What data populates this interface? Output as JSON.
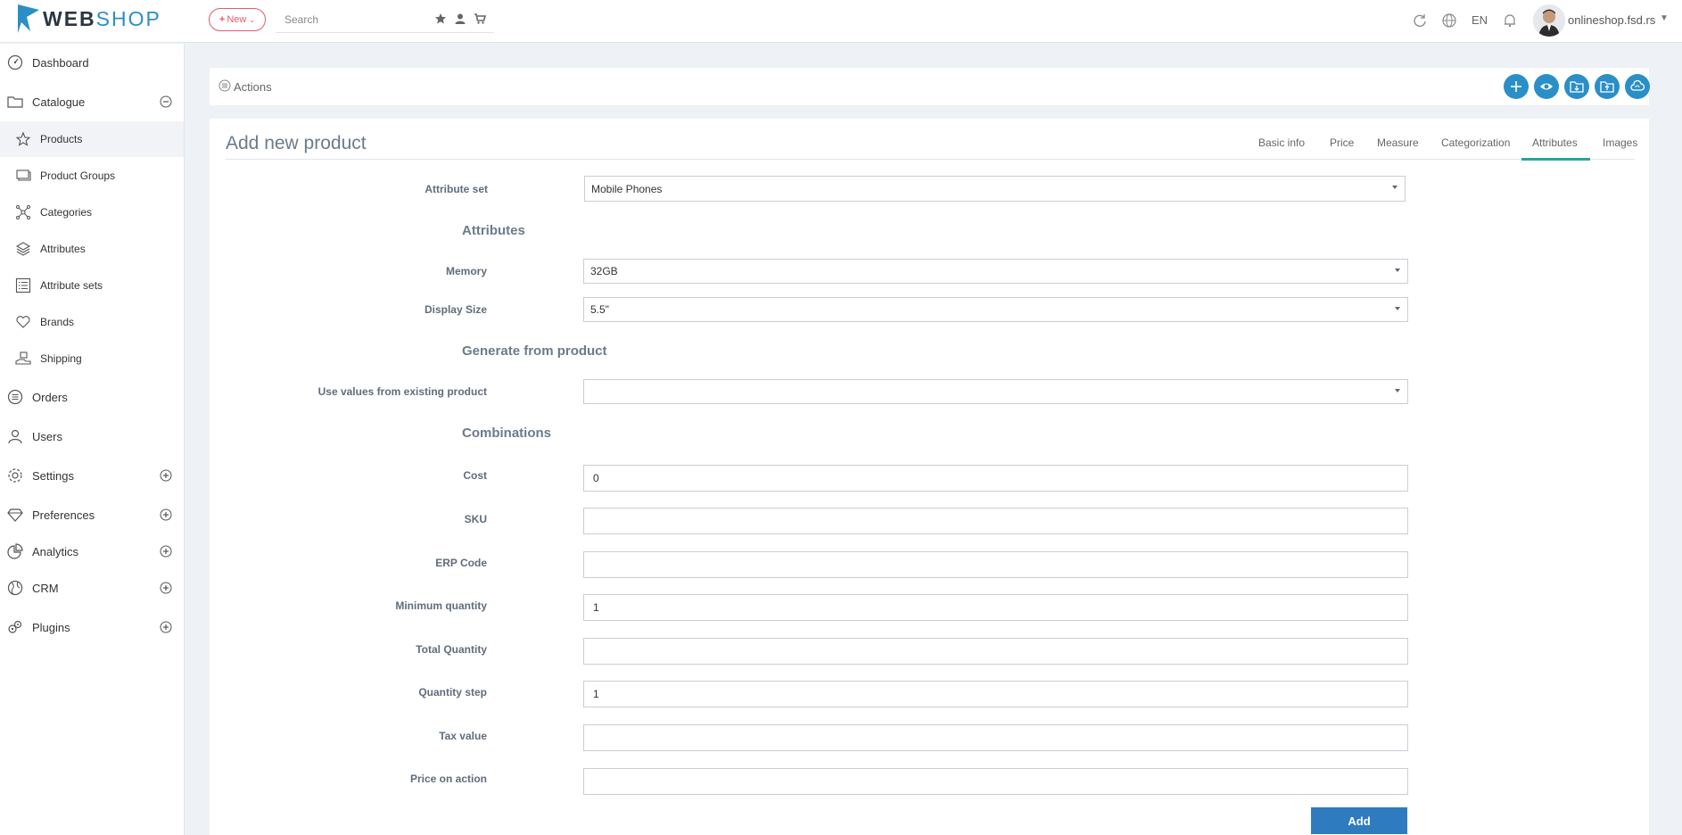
{
  "brand": {
    "logo_bold": "WEB",
    "logo_light": "SHOP"
  },
  "topbar": {
    "new_label": "New",
    "search_placeholder": "Search",
    "language": "EN",
    "user_name": "onlineshop.fsd.rs"
  },
  "sidebar": {
    "items": [
      {
        "label": "Dashboard",
        "icon": "dashboard-icon"
      },
      {
        "label": "Catalogue",
        "icon": "folder-icon",
        "toggle": "collapse"
      },
      {
        "label": "Products",
        "icon": "star-icon",
        "active": true
      },
      {
        "label": "Product Groups",
        "icon": "product-groups-icon"
      },
      {
        "label": "Categories",
        "icon": "categories-icon"
      },
      {
        "label": "Attributes",
        "icon": "layers-icon"
      },
      {
        "label": "Attribute sets",
        "icon": "list-icon"
      },
      {
        "label": "Brands",
        "icon": "heart-icon"
      },
      {
        "label": "Shipping",
        "icon": "shipping-icon"
      },
      {
        "label": "Orders",
        "icon": "orders-icon"
      },
      {
        "label": "Users",
        "icon": "users-icon"
      },
      {
        "label": "Settings",
        "icon": "settings-icon",
        "toggle": "expand"
      },
      {
        "label": "Preferences",
        "icon": "diamond-icon",
        "toggle": "expand"
      },
      {
        "label": "Analytics",
        "icon": "pie-chart-icon",
        "toggle": "expand"
      },
      {
        "label": "CRM",
        "icon": "globe-icon",
        "toggle": "expand"
      },
      {
        "label": "Plugins",
        "icon": "plugins-icon",
        "toggle": "expand"
      }
    ]
  },
  "actions": {
    "label": "Actions"
  },
  "page": {
    "title": "Add new product",
    "tabs": [
      "Basic info",
      "Price",
      "Measure",
      "Categorization",
      "Attributes",
      "Images"
    ],
    "active_tab": "Attributes"
  },
  "form": {
    "attribute_set": {
      "label": "Attribute set",
      "value": "Mobile Phones"
    },
    "attributes_heading": "Attributes",
    "memory": {
      "label": "Memory",
      "value": "32GB"
    },
    "display_size": {
      "label": "Display Size",
      "value": "5.5\""
    },
    "generate_heading": "Generate from product",
    "existing_product": {
      "label": "Use values from existing product",
      "value": ""
    },
    "combinations_heading": "Combinations",
    "cost": {
      "label": "Cost",
      "value": "0"
    },
    "sku": {
      "label": "SKU",
      "value": ""
    },
    "erp_code": {
      "label": "ERP Code",
      "value": ""
    },
    "min_qty": {
      "label": "Minimum quantity",
      "value": "1"
    },
    "total_qty": {
      "label": "Total Quantity",
      "value": ""
    },
    "qty_step": {
      "label": "Quantity step",
      "value": "1"
    },
    "tax_value": {
      "label": "Tax value",
      "value": ""
    },
    "price_on_action": {
      "label": "Price on action",
      "value": ""
    },
    "add_label": "Add"
  },
  "colors": {
    "accent": "#2a8fc7",
    "tab_active": "#26a69a",
    "new_button": "#e05c6a",
    "add_button": "#2f7bbf"
  }
}
